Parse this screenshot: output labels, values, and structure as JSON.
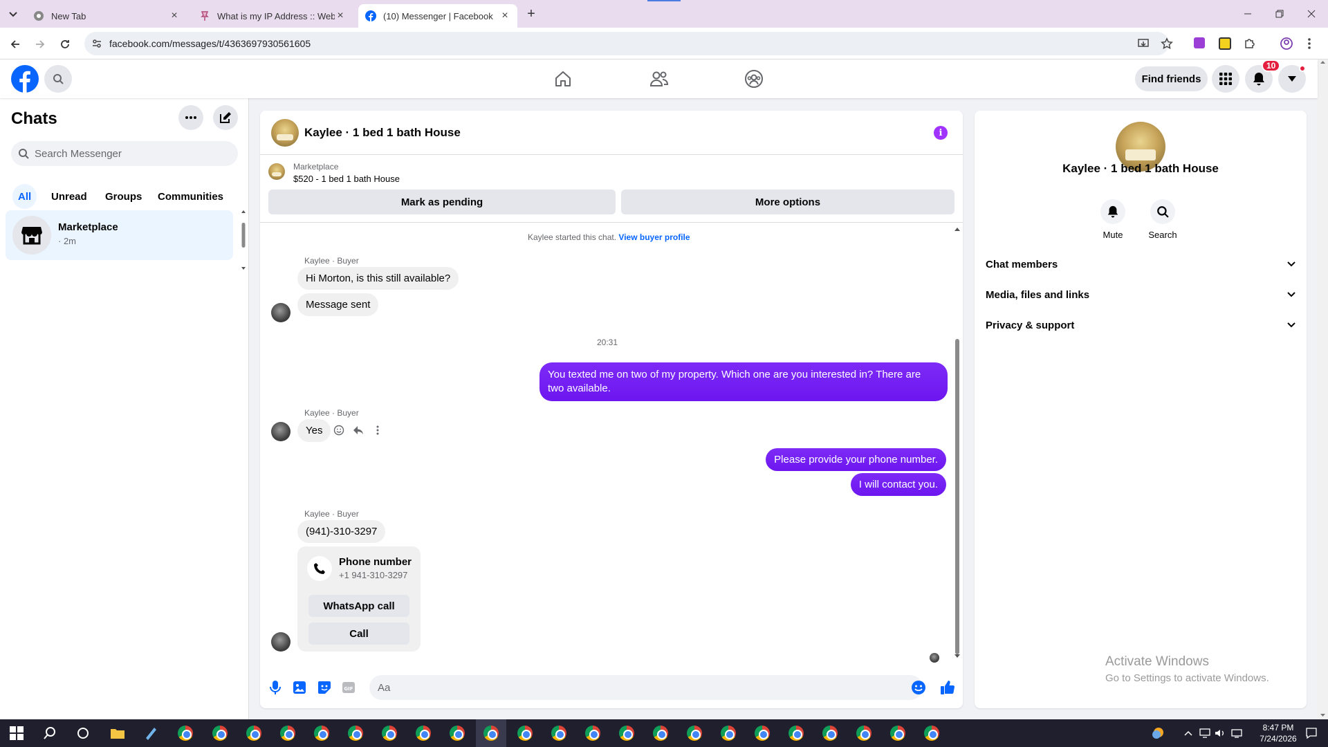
{
  "browser": {
    "tabs": [
      {
        "title": "New Tab",
        "active": false
      },
      {
        "title": "What is my IP Address :: WebBr",
        "active": false
      },
      {
        "title": "(10) Messenger | Facebook",
        "active": true
      }
    ],
    "url": "facebook.com/messages/t/4363697930561605"
  },
  "fbnav": {
    "find_friends": "Find friends",
    "notification_count": "10"
  },
  "sidebar": {
    "title": "Chats",
    "search_placeholder": "Search Messenger",
    "filters": [
      "All",
      "Unread",
      "Groups",
      "Communities"
    ],
    "active_filter": "All",
    "chats": [
      {
        "name": "Marketplace",
        "time": "· 2m"
      }
    ]
  },
  "conversation": {
    "title": "Kaylee · 1 bed 1 bath House",
    "marketplace": {
      "label": "Marketplace",
      "item": "$520 - 1 bed 1 bath House",
      "mark_pending": "Mark as pending",
      "more_options": "More options"
    },
    "started_text": "Kaylee started this chat.",
    "view_profile": "View buyer profile",
    "sender_label": "Kaylee · Buyer",
    "messages": {
      "m1": "Hi Morton, is this still available?",
      "m2": "Message sent",
      "time": "20:31",
      "m3": "You texted me on two of my property. Which one are you interested in? There are two available.",
      "m4": "Yes",
      "m5": "Please provide your phone number.",
      "m6": "I will contact you.",
      "m7": "(941)-310-3297"
    },
    "phone_card": {
      "title": "Phone number",
      "number": "+1 941-310-3297",
      "whatsapp": "WhatsApp call",
      "call": "Call"
    },
    "input_placeholder": "Aa"
  },
  "info_panel": {
    "name": "Kaylee · 1 bed 1 bath House",
    "mute": "Mute",
    "search": "Search",
    "sections": [
      "Chat members",
      "Media, files and links",
      "Privacy & support"
    ]
  },
  "watermark": {
    "title": "Activate Windows",
    "subtitle": "Go to Settings to activate Windows."
  },
  "taskbar": {
    "time": "8:47 PM",
    "date": "7/24/2026"
  },
  "colors": {
    "fb_blue": "#0866ff",
    "outgoing_bubble": "#7b1fff",
    "notification_red": "#e41e3f",
    "info_purple": "#a033ff"
  }
}
